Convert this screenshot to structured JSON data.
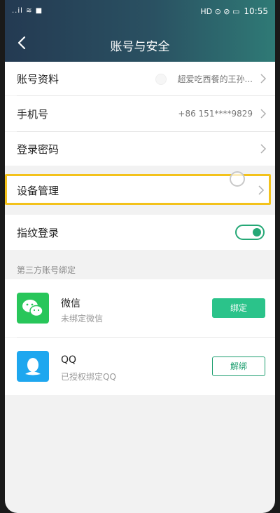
{
  "status": {
    "left": "..il ≋ ■",
    "right_icons": "HD ⊙ ⊘ ▭",
    "time": "10:55"
  },
  "header": {
    "title": "账号与安全"
  },
  "rows": {
    "profile": {
      "label": "账号资料",
      "value": "超爱吃西餐的王孙..."
    },
    "phone": {
      "label": "手机号",
      "value": "+86 151****9829"
    },
    "password": {
      "label": "登录密码"
    },
    "devices": {
      "label": "设备管理"
    },
    "fingerprint": {
      "label": "指纹登录",
      "enabled": true
    }
  },
  "third_party": {
    "section_title": "第三方账号绑定",
    "wechat": {
      "name": "微信",
      "status": "未绑定微信",
      "button": "绑定"
    },
    "qq": {
      "name": "QQ",
      "status": "已授权绑定QQ",
      "button": "解绑"
    }
  },
  "colors": {
    "accent": "#25a876",
    "highlight": "#f3c21b",
    "wechat": "#28c65a",
    "qq": "#1ea7ef"
  }
}
